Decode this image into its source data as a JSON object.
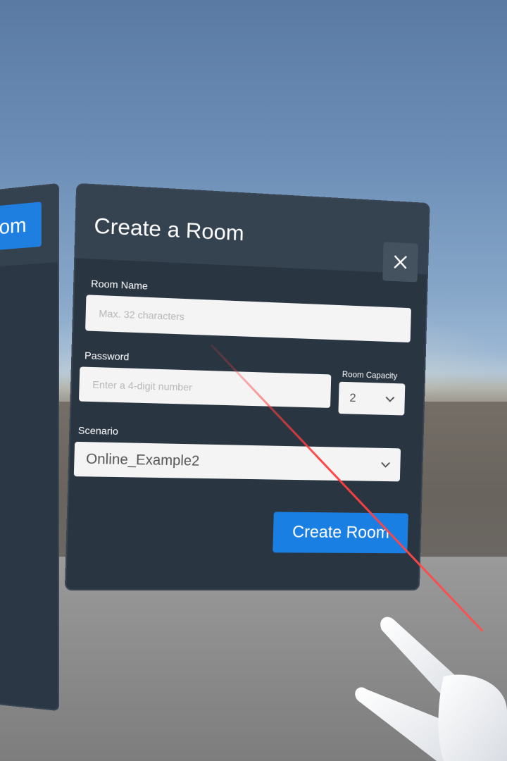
{
  "left_panel": {
    "button_label": "om"
  },
  "dialog": {
    "title": "Create a Room",
    "close_icon": "close-icon",
    "room_name": {
      "label": "Room Name",
      "placeholder": "Max. 32 characters",
      "value": ""
    },
    "password": {
      "label": "Password",
      "placeholder": "Enter a 4-digit number",
      "value": ""
    },
    "room_capacity": {
      "label": "Room Capacity",
      "selected": "2"
    },
    "scenario": {
      "label": "Scenario",
      "selected": "Online_Example2"
    },
    "create_button_label": "Create Room"
  },
  "colors": {
    "panel_bg": "#2a3542",
    "panel_header": "#354250",
    "accent_blue": "#1a7fe2",
    "laser_red": "#ff3c3c"
  }
}
